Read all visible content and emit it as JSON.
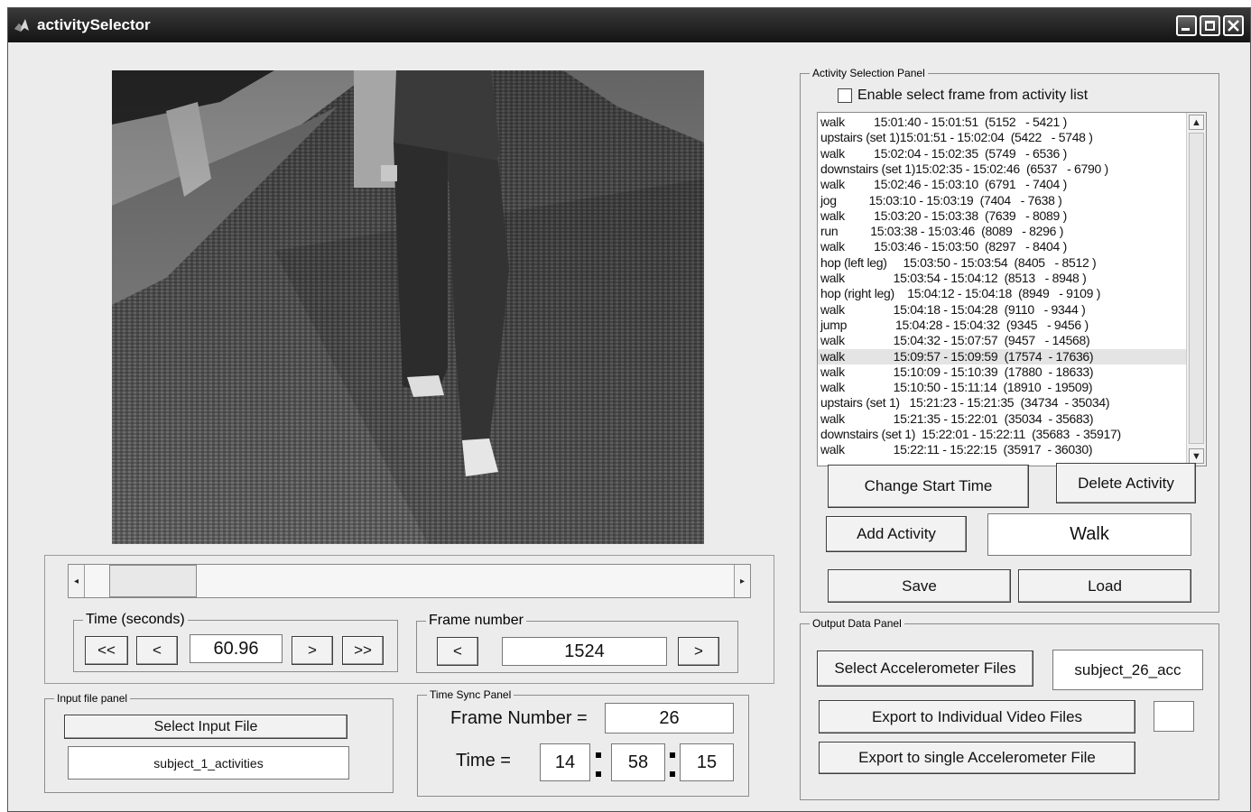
{
  "window": {
    "title": "activitySelector"
  },
  "activity_panel": {
    "title": "Activity Selection Panel",
    "enable_checkbox_label": "Enable select frame from activity list",
    "enable_checked": false,
    "activities": [
      "walk         15:01:40 - 15:01:51  (5152   - 5421 )",
      "upstairs (set 1)15:01:51 - 15:02:04  (5422   - 5748 )",
      "walk         15:02:04 - 15:02:35  (5749   - 6536 )",
      "downstairs (set 1)15:02:35 - 15:02:46  (6537   - 6790 )",
      "walk         15:02:46 - 15:03:10  (6791   - 7404 )",
      "jog          15:03:10 - 15:03:19  (7404   - 7638 )",
      "walk         15:03:20 - 15:03:38  (7639   - 8089 )",
      "run          15:03:38 - 15:03:46  (8089   - 8296 )",
      "walk         15:03:46 - 15:03:50  (8297   - 8404 )",
      "hop (left leg)     15:03:50 - 15:03:54  (8405   - 8512 )",
      "walk               15:03:54 - 15:04:12  (8513   - 8948 )",
      "hop (right leg)    15:04:12 - 15:04:18  (8949   - 9109 )",
      "walk               15:04:18 - 15:04:28  (9110   - 9344 )",
      "jump               15:04:28 - 15:04:32  (9345   - 9456 )",
      "walk               15:04:32 - 15:07:57  (9457   - 14568)",
      "walk               15:09:57 - 15:09:59  (17574  - 17636)",
      "walk               15:10:09 - 15:10:39  (17880  - 18633)",
      "walk               15:10:50 - 15:11:14  (18910  - 19509)",
      "upstairs (set 1)   15:21:23 - 15:21:35  (34734  - 35034)",
      "walk               15:21:35 - 15:22:01  (35034  - 35683)",
      "downstairs (set 1)  15:22:01 - 15:22:11  (35683  - 35917)",
      "walk               15:22:11 - 15:22:15  (35917  - 36030)"
    ],
    "selected_index": 15,
    "change_start_time": "Change Start Time",
    "delete_activity": "Delete Activity",
    "add_activity": "Add Activity",
    "activity_name_value": "Walk",
    "save": "Save",
    "load": "Load"
  },
  "output_panel": {
    "title": "Output Data Panel",
    "select_acc_files": "Select Accelerometer Files",
    "acc_file_value": "subject_26_acc",
    "export_individual": "Export to Individual Video Files",
    "export_individual_value": "",
    "export_single": "Export to single Accelerometer File"
  },
  "playback": {
    "slider_position_fraction": 0.04,
    "time_group_label": "Time (seconds)",
    "time_btn_fast_back": "<<",
    "time_btn_back": "<",
    "time_value": "60.96",
    "time_btn_fwd": ">",
    "time_btn_fast_fwd": ">>",
    "frame_group_label": "Frame number",
    "frame_btn_back": "<",
    "frame_value": "1524",
    "frame_btn_fwd": ">"
  },
  "input_panel": {
    "title": "Input file panel",
    "select_input": "Select Input File",
    "input_file_value": "subject_1_activities"
  },
  "time_sync": {
    "title": "Time Sync Panel",
    "frame_number_label": "Frame Number =",
    "frame_number_value": "26",
    "time_label": "Time =",
    "hours": "14",
    "minutes": "58",
    "seconds": "15"
  }
}
